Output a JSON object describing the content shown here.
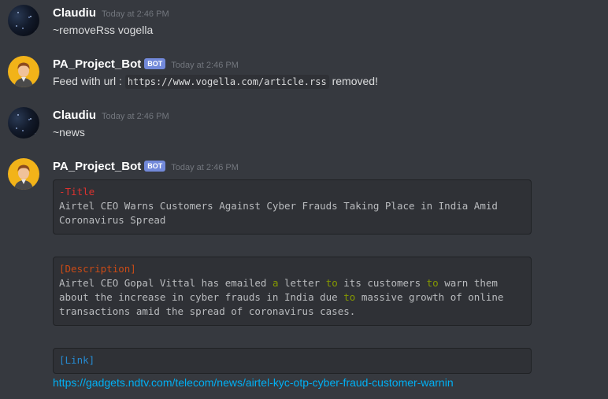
{
  "messages": [
    {
      "username": "Claudiu",
      "timestamp": "Today at 2:46 PM",
      "text": "~removeRss vogella"
    },
    {
      "username": "PA_Project_Bot",
      "badge": "BOT",
      "timestamp": "Today at 2:46 PM",
      "text_before": "Feed with url :",
      "code": "https://www.vogella.com/article.rss",
      "text_after": "removed!"
    },
    {
      "username": "Claudiu",
      "timestamp": "Today at 2:46 PM",
      "text": "~news"
    },
    {
      "username": "PA_Project_Bot",
      "badge": "BOT",
      "timestamp": "Today at 2:46 PM",
      "title_tag": "-Title",
      "title_line1": "Airtel CEO Warns Customers Against Cyber Frauds Taking Place in India Amid",
      "title_line2": "Coronavirus Spread",
      "desc_tag": "[Description]",
      "desc_p1": "Airtel CEO Gopal Vittal has emailed ",
      "desc_a": "a",
      "desc_p2": " letter ",
      "desc_to1": "to",
      "desc_p3": " its customers ",
      "desc_to2": "to",
      "desc_p4": " warn them",
      "desc_line2a": "about the increase in cyber frauds in India due ",
      "desc_to3": "to",
      "desc_line2b": " massive growth of online",
      "desc_line3": "transactions amid the spread of coronavirus cases.",
      "link_tag": "[Link]",
      "link_url": "https://gadgets.ndtv.com/telecom/news/airtel-kyc-otp-cyber-fraud-customer-warnin"
    }
  ],
  "colors": {
    "background": "#36393f",
    "bot_badge": "#7289da",
    "link": "#00b0f4",
    "codeblock": "#2f3136"
  }
}
